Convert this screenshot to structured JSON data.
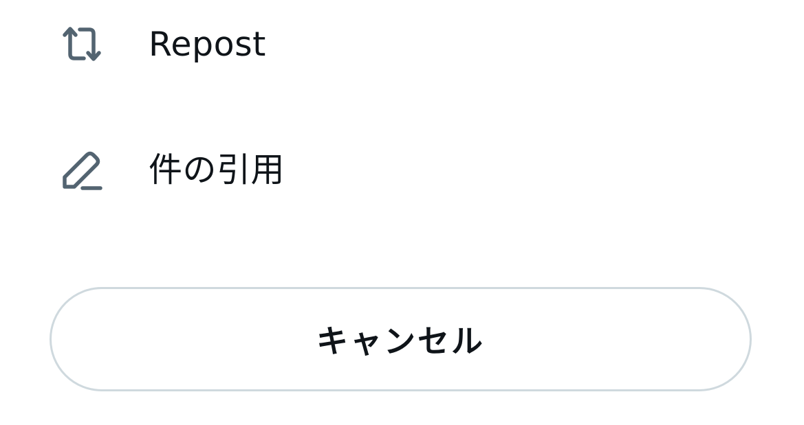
{
  "menu": {
    "items": [
      {
        "label": "Repost",
        "icon": "repost-icon"
      },
      {
        "label": "件の引用",
        "icon": "pencil-icon"
      }
    ]
  },
  "cancel": {
    "label": "キャンセル"
  },
  "colors": {
    "icon": "#536471",
    "text": "#0f1419",
    "border": "#cfd9de",
    "background": "#ffffff"
  }
}
